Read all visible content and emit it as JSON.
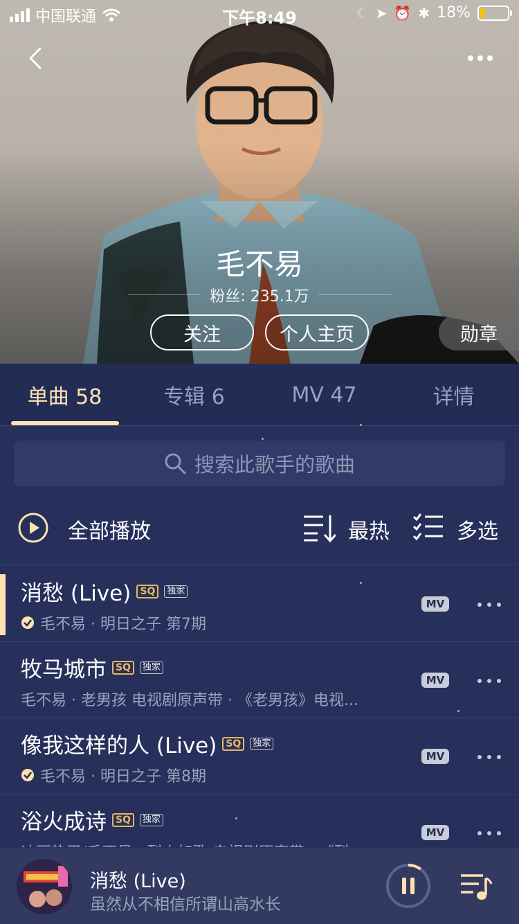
{
  "status_bar": {
    "carrier": "中国联通",
    "time": "下午8:49",
    "battery": "18%",
    "battery_level": 0.18
  },
  "artist": {
    "name": "毛不易",
    "fans": "粉丝: 235.1万",
    "follow_label": "关注",
    "home_label": "个人主页",
    "medal_label": "勋章"
  },
  "tabs": [
    {
      "label": "单曲 58",
      "active": true
    },
    {
      "label": "专辑 6",
      "active": false
    },
    {
      "label": "MV 47",
      "active": false
    },
    {
      "label": "详情",
      "active": false
    }
  ],
  "search": {
    "placeholder": "搜索此歌手的歌曲"
  },
  "actions": {
    "play_all": "全部播放",
    "sort": "最热",
    "multi_select": "多选"
  },
  "badges": {
    "sq": "SQ",
    "exclusive": "独家",
    "mv": "MV"
  },
  "songs": [
    {
      "title": "消愁 (Live)",
      "subtitle": "毛不易 · 明日之子 第7期",
      "verified": true,
      "playing": true
    },
    {
      "title": "牧马城市",
      "subtitle": "毛不易 · 老男孩 电视剧原声带 · 《老男孩》电视...",
      "verified": false,
      "playing": false
    },
    {
      "title": "像我这样的人 (Live)",
      "subtitle": "毛不易 · 明日之子 第8期",
      "verified": true,
      "playing": false
    },
    {
      "title": "浴火成诗",
      "subtitle": "迪丽热巴/毛不易 · 烈火如歌 电视剧原声带 · 《烈...",
      "verified": false,
      "playing": false
    }
  ],
  "now_playing": {
    "title": "消愁 (Live)",
    "lyric": "虽然从不相信所谓山高水长",
    "progress": 0.1
  },
  "colors": {
    "background": "#26305a",
    "accent": "#ffe2b0",
    "sq_badge": "#e8b660",
    "muted_text": "#9aa1bd"
  }
}
